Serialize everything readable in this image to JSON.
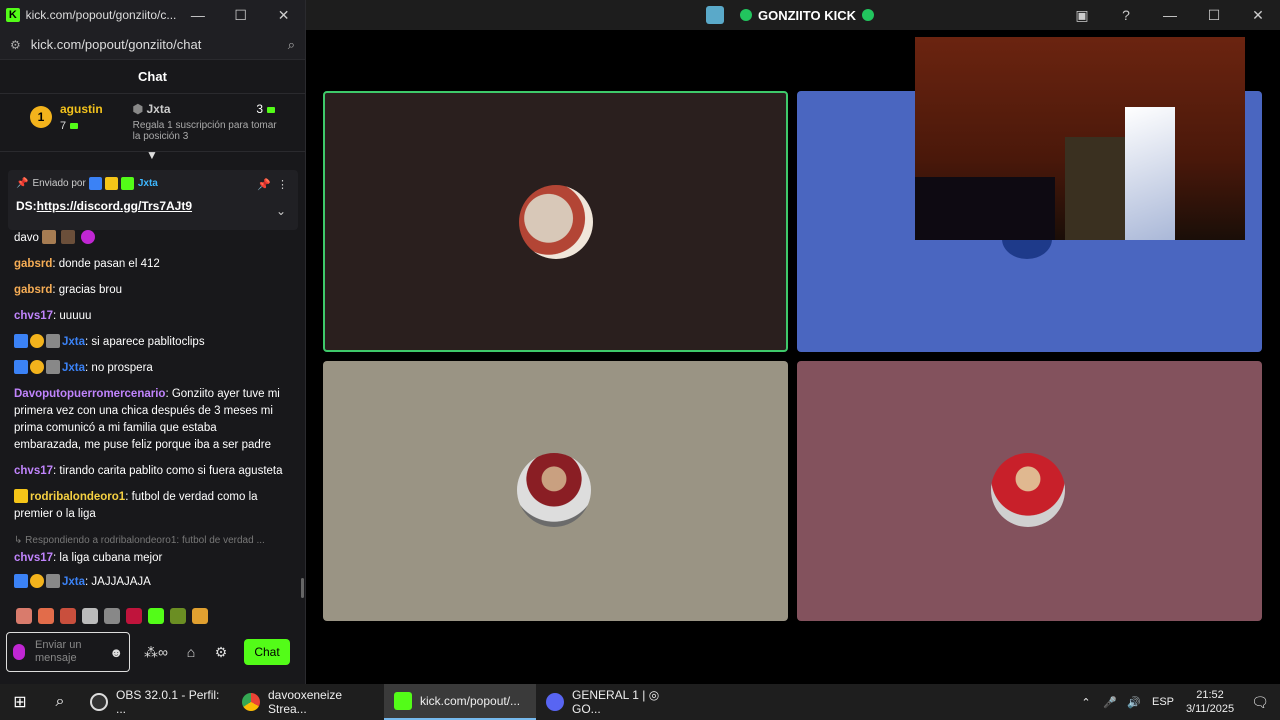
{
  "chat_window": {
    "title": "kick.com/popout/gonziito/c...",
    "url": "kick.com/popout/gonziito/chat",
    "header": "Chat"
  },
  "leaderboard": {
    "first": {
      "rank": "1",
      "name": "agustin",
      "count": "7"
    },
    "second": {
      "name": "Jxta",
      "hint": "Regala 1 suscripción para tomar la posición 3"
    },
    "third": {
      "count": "3"
    }
  },
  "pinned": {
    "sent_by": "Enviado por",
    "user": "Jxta",
    "message_prefix": "DS:",
    "link": "https://discord.gg/Trs7AJt9"
  },
  "messages": [
    {
      "user": "davo",
      "text": ""
    },
    {
      "user": "gabsrd",
      "text": "donde pasan el 412"
    },
    {
      "user": "gabsrd",
      "text": "gracias brou"
    },
    {
      "user": "chvs17",
      "text": "uuuuu"
    },
    {
      "user": "Jxta",
      "text": "si aparece pablitoclips"
    },
    {
      "user": "Jxta",
      "text": "no prospera"
    },
    {
      "user": "Davoputopuerromercenario",
      "text": "Gonziito ayer tuve mi primera vez con una chica después de 3 meses mi prima comunicó a mi familia que estaba embarazada, me puse feliz porque iba a ser padre"
    },
    {
      "user": "chvs17",
      "text": "tirando carita pablito como si fuera agusteta"
    },
    {
      "user": "rodribalondeoro1",
      "text": "futbol de verdad como la premier o la liga"
    },
    {
      "reply": "Respondiendo a rodribalondeoro1: futbol de verdad ...",
      "user": "chvs17",
      "text": "la liga cubana mejor"
    },
    {
      "user": "Jxta",
      "text": "JAJJAJAJA"
    }
  ],
  "input": {
    "placeholder": "Enviar un mensaje",
    "send_label": "Chat",
    "infinity": "∞"
  },
  "obs": {
    "title": "GONZIITO KICK"
  },
  "taskbar": {
    "apps": [
      {
        "label": "OBS 32.0.1 - Perfil: ...",
        "color": "#333"
      },
      {
        "label": "davooxeneize Strea...",
        "color": "#4285f4"
      },
      {
        "label": "kick.com/popout/...",
        "color": "#53fc18"
      },
      {
        "label": "GENERAL 1 | ◎ GO...",
        "color": "#5865f2"
      }
    ],
    "lang": "ESP",
    "time": "21:52",
    "date": "3/11/2025"
  }
}
